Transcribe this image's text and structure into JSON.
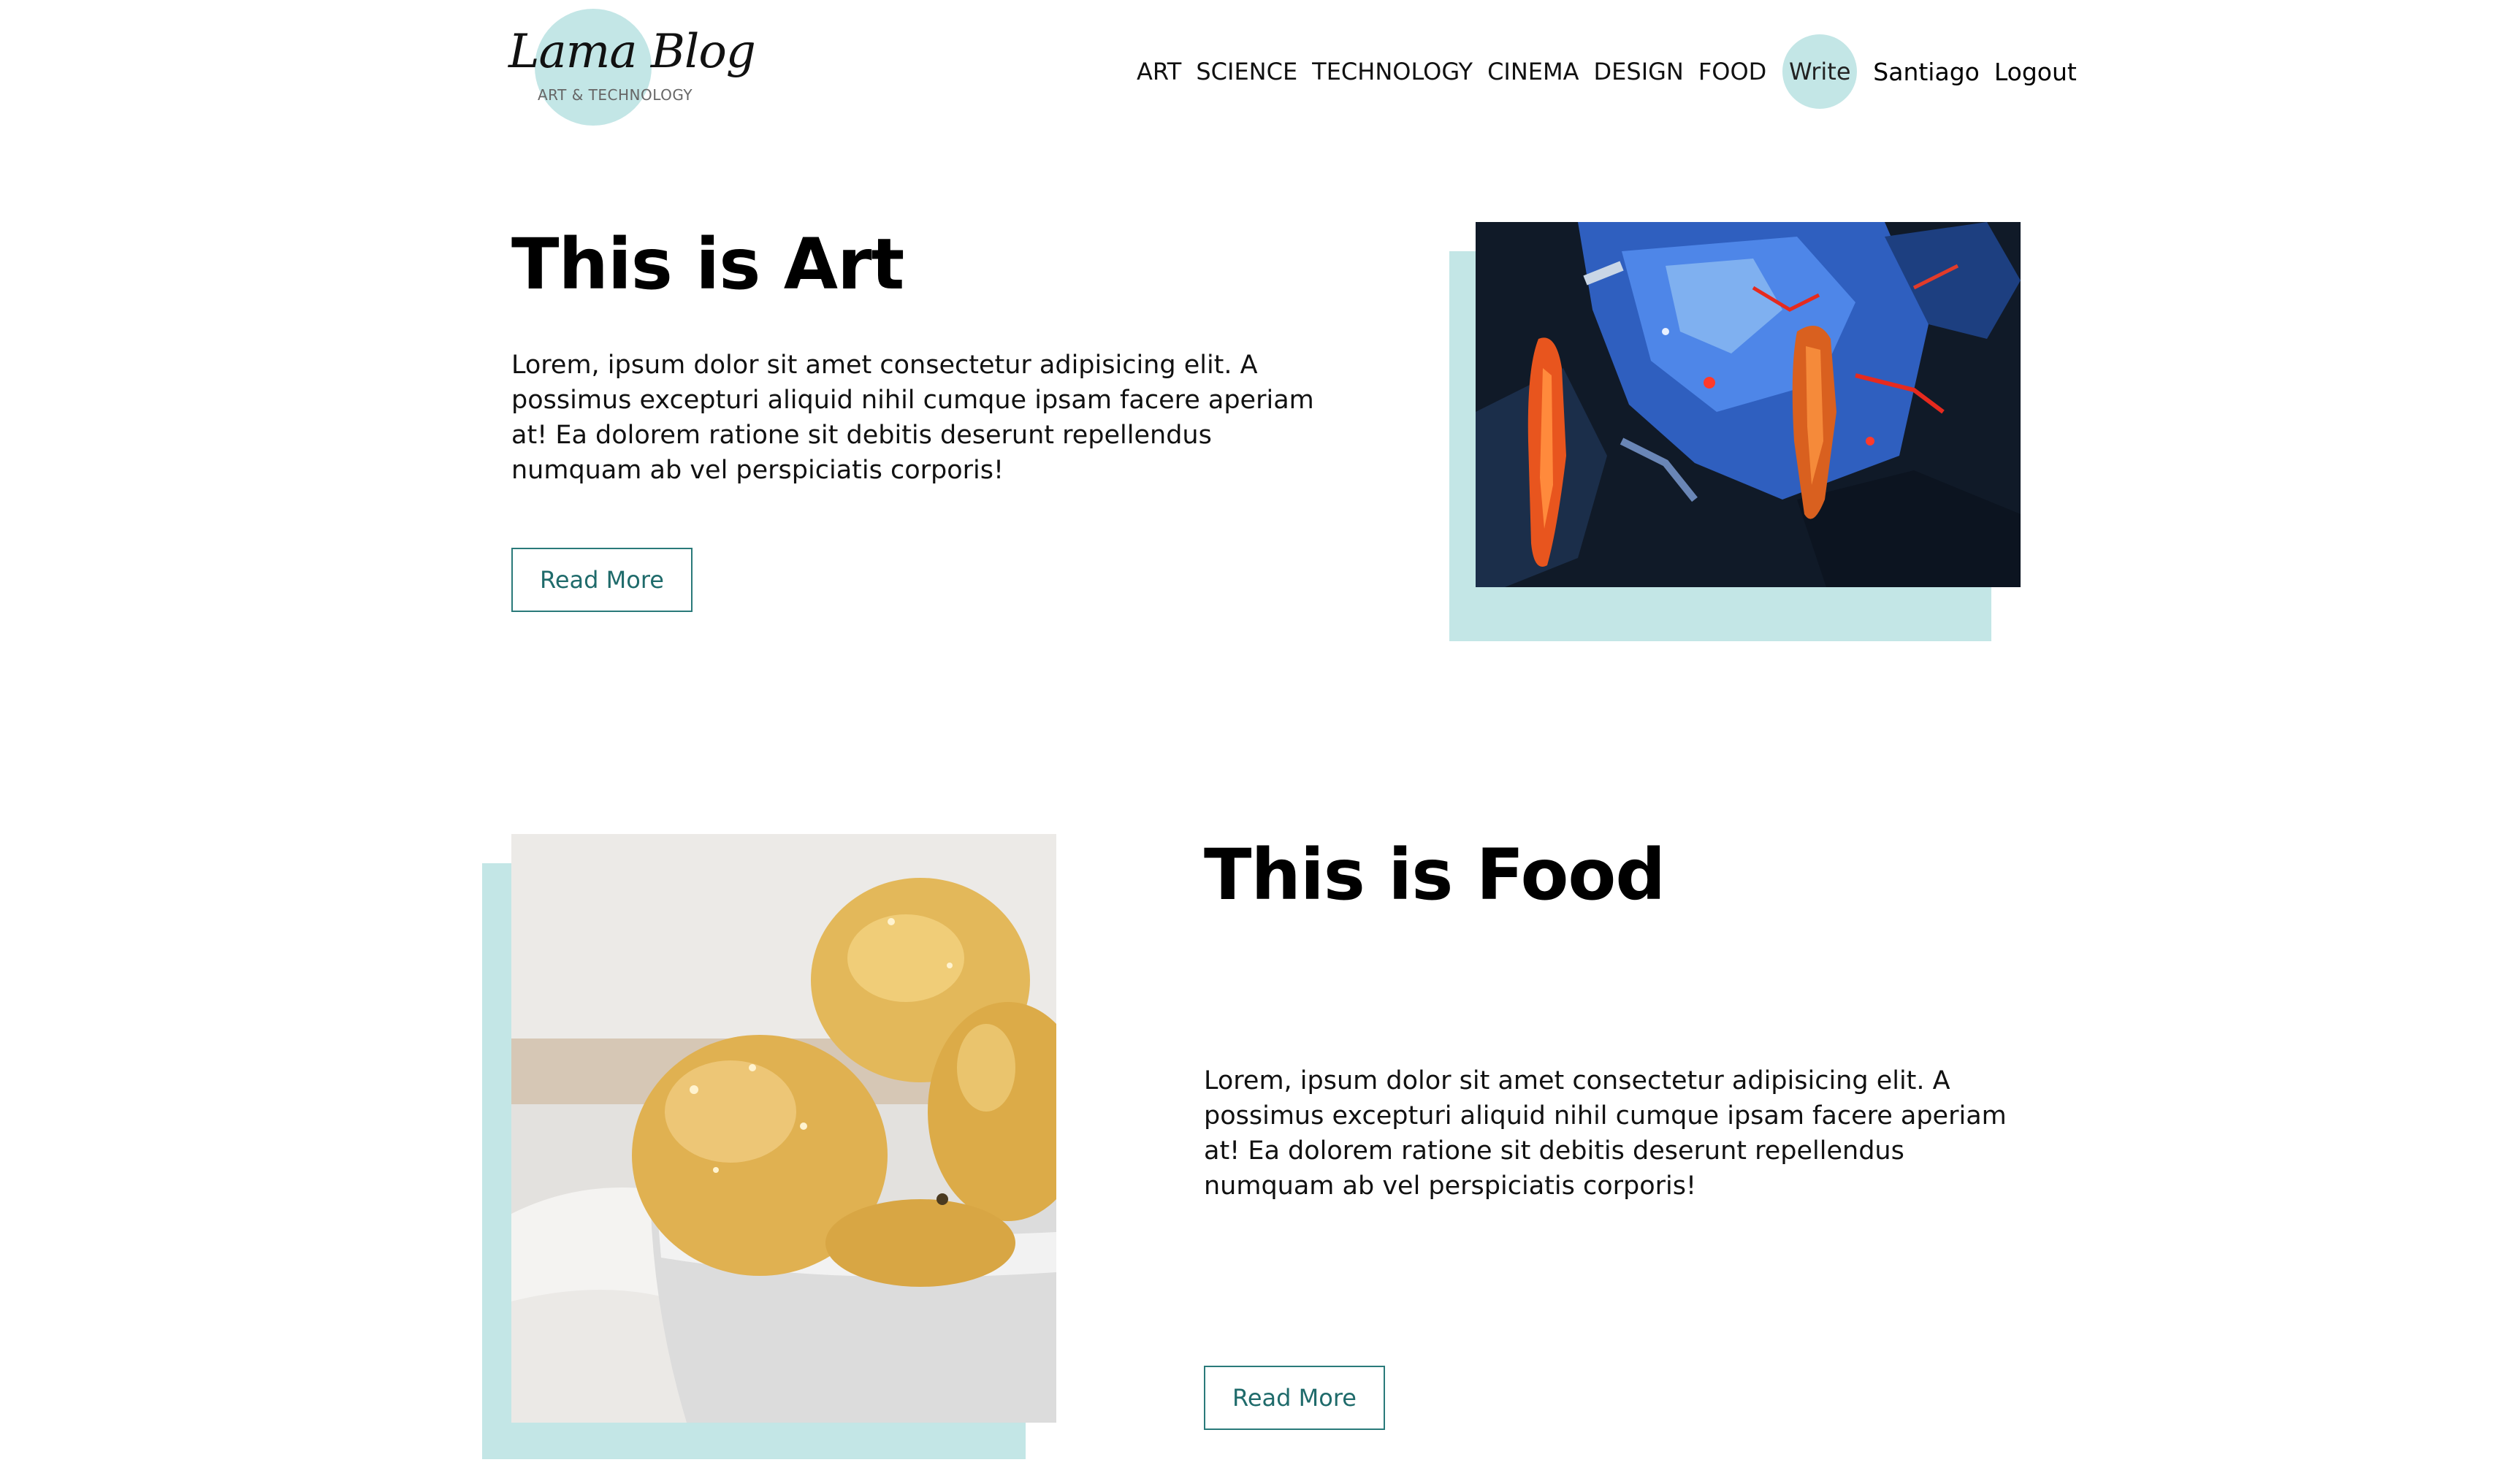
{
  "header": {
    "logo_title": "Lama Blog",
    "logo_subtitle": "ART & TECHNOLOGY",
    "nav": [
      "ART",
      "SCIENCE",
      "TECHNOLOGY",
      "CINEMA",
      "DESIGN",
      "FOOD"
    ],
    "write_label": "Write",
    "user_name": "Santiago",
    "logout_label": "Logout"
  },
  "posts": [
    {
      "title": "This is Art",
      "description": "Lorem, ipsum dolor sit amet consectetur adipisicing elit. A possimus excepturi aliquid nihil cumque ipsam facere aperiam at! Ea dolorem ratione sit debitis deserunt repellendus numquam ab vel perspiciatis corporis!",
      "button_label": "Read More",
      "image": "abstract-painting-image"
    },
    {
      "title": "This is Food",
      "description": "Lorem, ipsum dolor sit amet consectetur adipisicing elit. A possimus excepturi aliquid nihil cumque ipsam facere aperiam at! Ea dolorem ratione sit debitis deserunt repellendus numquam ab vel perspiciatis corporis!",
      "button_label": "Read More",
      "image": "lemons-bowl-image"
    }
  ],
  "colors": {
    "accent": "#c3e6e6",
    "button_border": "#2a7a7a",
    "button_text": "#1f6b6b"
  }
}
